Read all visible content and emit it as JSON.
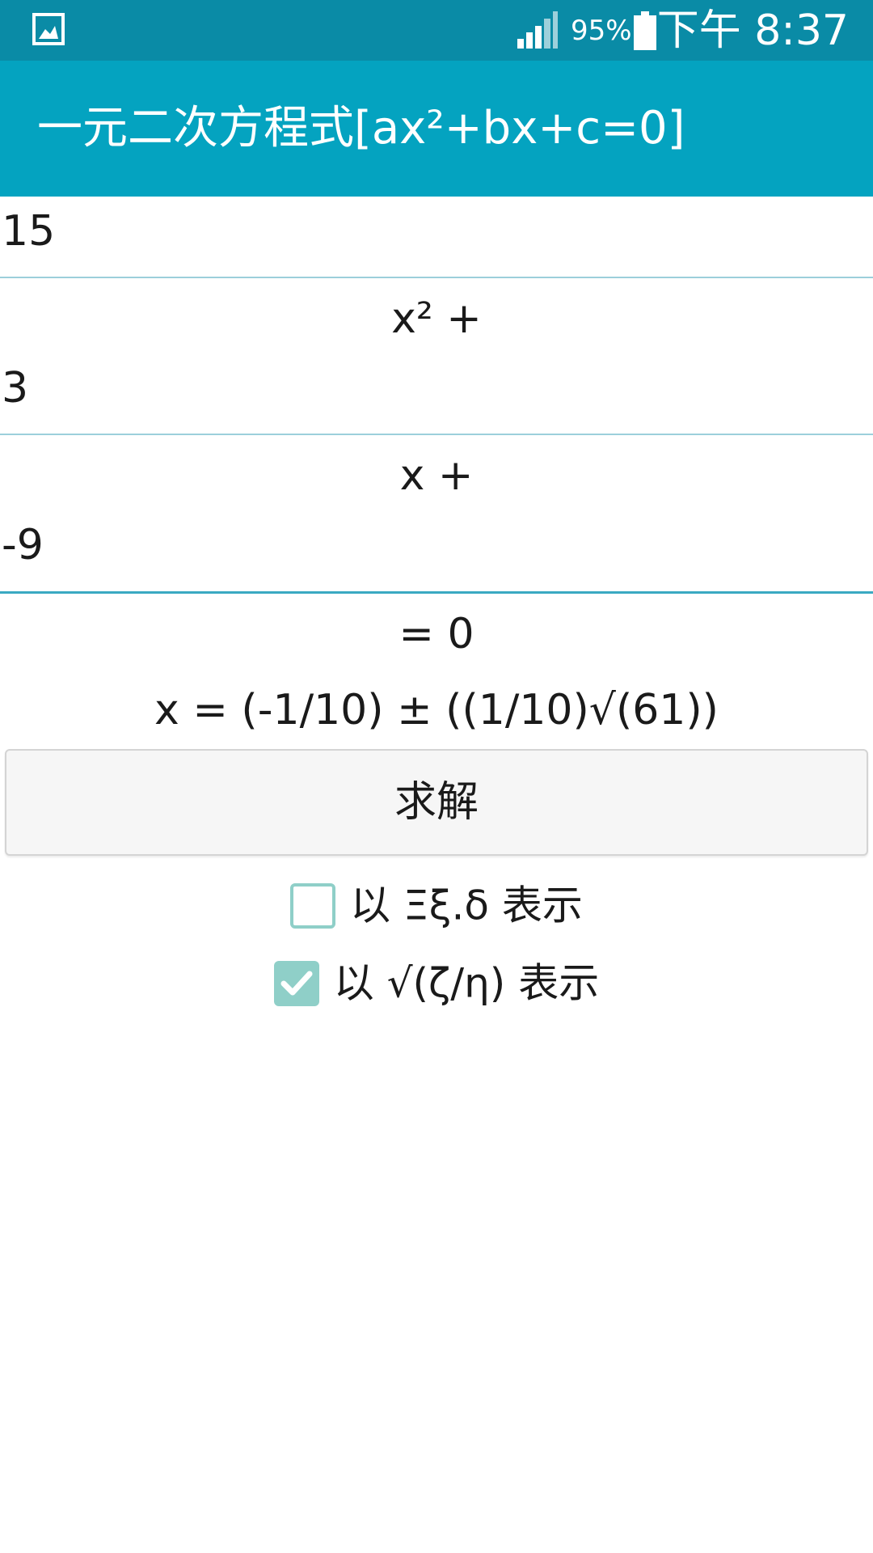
{
  "status_bar": {
    "battery_percent": "95%",
    "time": "下午 8:37",
    "icons": [
      "gallery-icon",
      "signal-icon",
      "battery-icon"
    ]
  },
  "app_bar": {
    "title": "一元二次方程式[ax²+bx+c=0]"
  },
  "equation": {
    "a_value": "15",
    "a_suffix": "x² +",
    "b_value": "3",
    "b_suffix": "x +",
    "c_value": "-9",
    "c_suffix": "= 0",
    "result": "x = (-1/10) ± ((1/10)√(61))"
  },
  "solve_button": {
    "label": "求解"
  },
  "options": [
    {
      "label": "以 Ξξ.δ 表示",
      "checked": false
    },
    {
      "label": "以 √(ζ/η) 表示",
      "checked": true
    }
  ],
  "colors": {
    "status_bar": "#0a8ba6",
    "app_bar": "#04a3c0",
    "field_underline": "#9ccfdb",
    "checkbox": "#8fcfc8"
  }
}
